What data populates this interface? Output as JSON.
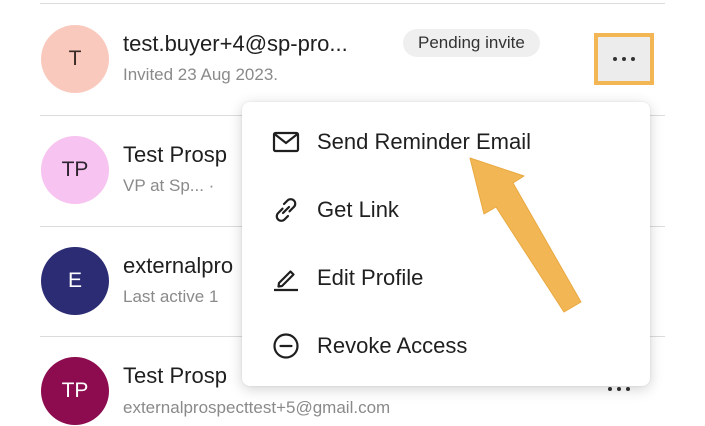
{
  "contacts": [
    {
      "initials": "T",
      "name": "test.buyer+4@sp-pro...",
      "subtitle": "Invited 23 Aug 2023.",
      "badge": "Pending invite",
      "avatar_bg": "#f9c9bd",
      "avatar_fg": "#3a2b27"
    },
    {
      "initials": "TP",
      "name": "Test Prosp",
      "subtitle": "VP at Sp... ·",
      "avatar_bg": "#f7c3f0",
      "avatar_fg": "#2e2330"
    },
    {
      "initials": "E",
      "name": "externalpro",
      "subtitle": "Last active 1",
      "avatar_bg": "#2c2c74",
      "avatar_fg": "#ffffff"
    },
    {
      "initials": "TP",
      "name": "Test Prosp",
      "subtitle": "externalprospecttest+5@gmail.com",
      "avatar_bg": "#8c0c4f",
      "avatar_fg": "#ffffff"
    }
  ],
  "menu": {
    "items": [
      {
        "label": "Send Reminder Email",
        "icon": "mail-icon"
      },
      {
        "label": "Get Link",
        "icon": "link-icon"
      },
      {
        "label": "Edit Profile",
        "icon": "pencil-icon"
      },
      {
        "label": "Revoke Access",
        "icon": "minus-circle-icon"
      }
    ]
  },
  "colors": {
    "highlight": "#f2b655",
    "arrow": "#f2b655"
  }
}
